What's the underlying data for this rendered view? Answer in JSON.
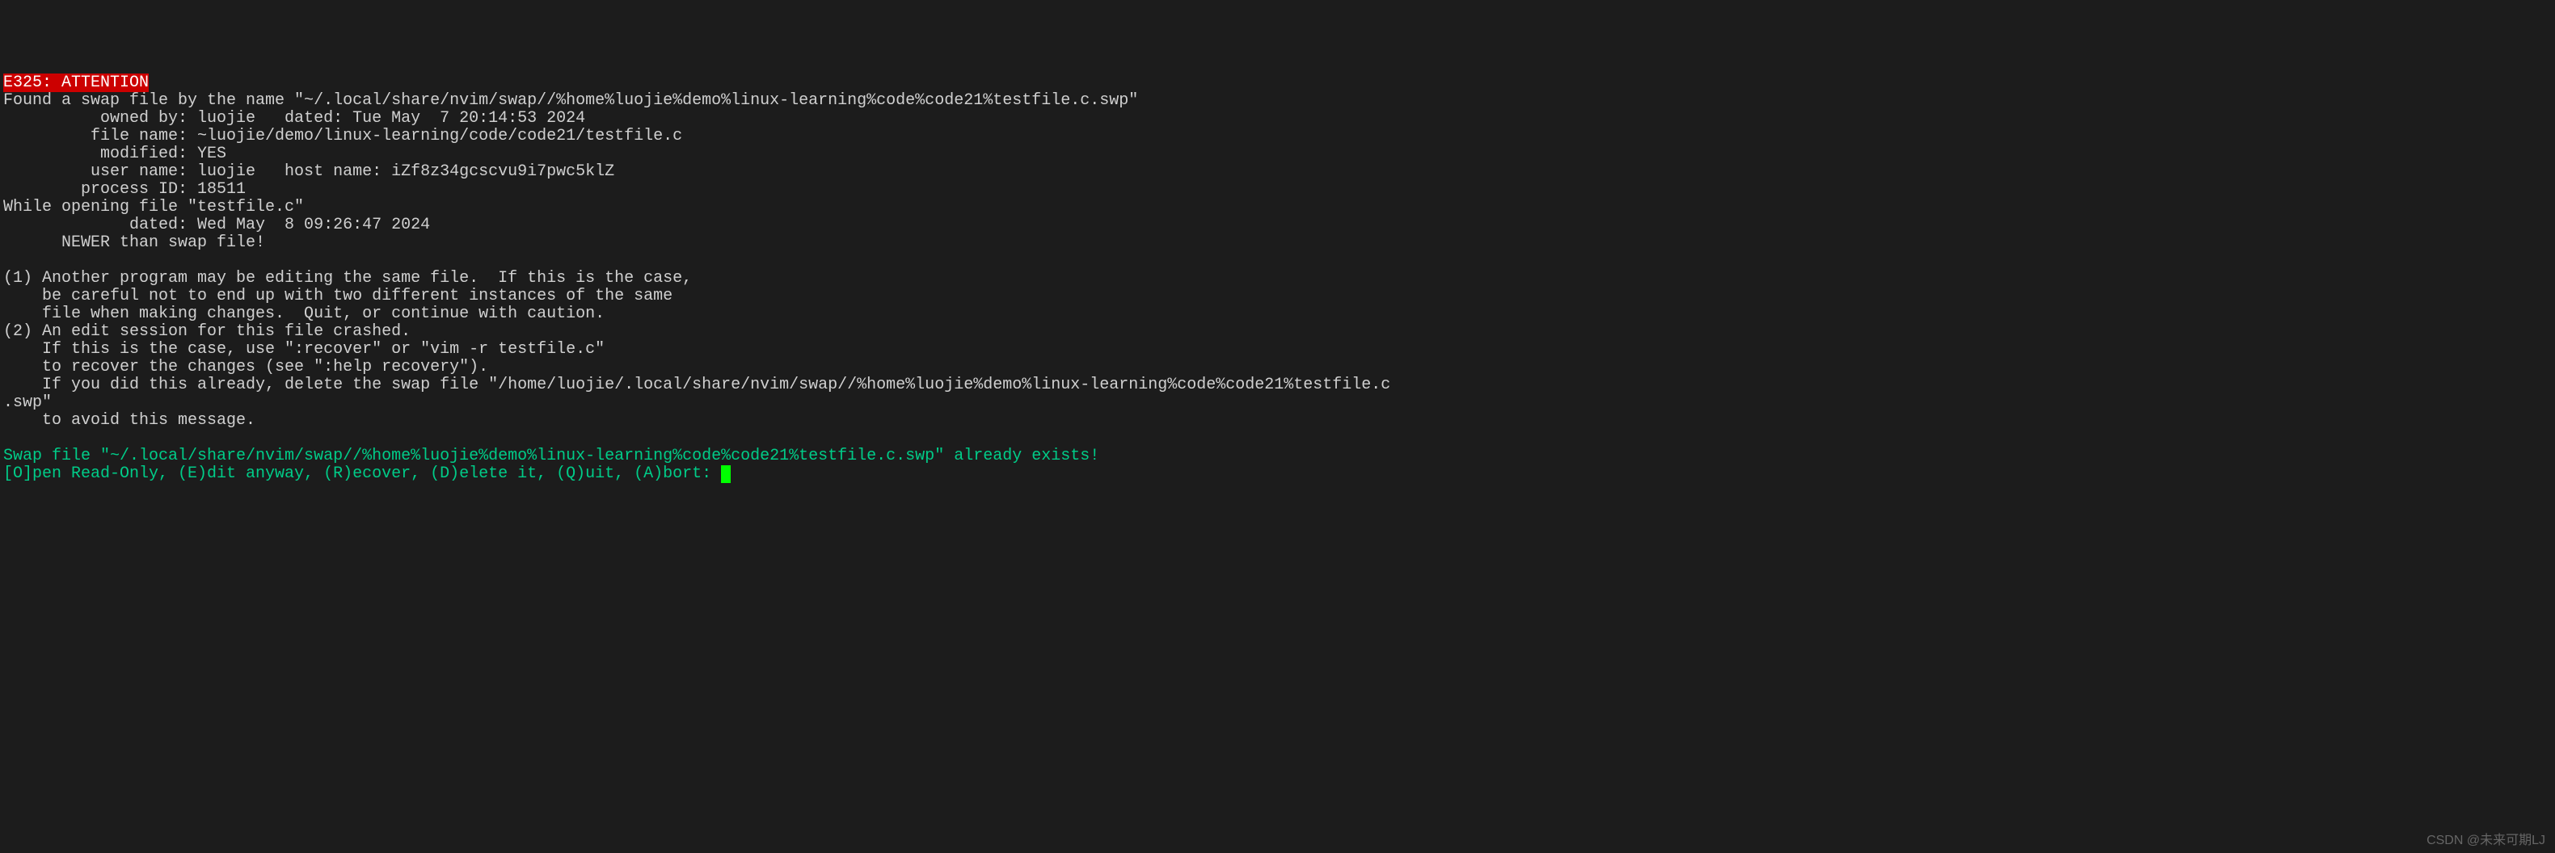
{
  "error": {
    "code": "E325: ATTENTION"
  },
  "lines": {
    "l1": "Found a swap file by the name \"~/.local/share/nvim/swap//%home%luojie%demo%linux-learning%code%code21%testfile.c.swp\"",
    "l2": "          owned by: luojie   dated: Tue May  7 20:14:53 2024",
    "l3": "         file name: ~luojie/demo/linux-learning/code/code21/testfile.c",
    "l4": "          modified: YES",
    "l5": "         user name: luojie   host name: iZf8z34gcscvu9i7pwc5klZ",
    "l6": "        process ID: 18511",
    "l7": "While opening file \"testfile.c\"",
    "l8": "             dated: Wed May  8 09:26:47 2024",
    "l9": "      NEWER than swap file!",
    "l10": "",
    "l11": "(1) Another program may be editing the same file.  If this is the case,",
    "l12": "    be careful not to end up with two different instances of the same",
    "l13": "    file when making changes.  Quit, or continue with caution.",
    "l14": "(2) An edit session for this file crashed.",
    "l15": "    If this is the case, use \":recover\" or \"vim -r testfile.c\"",
    "l16": "    to recover the changes (see \":help recovery\").",
    "l17": "    If you did this already, delete the swap file \"/home/luojie/.local/share/nvim/swap//%home%luojie%demo%linux-learning%code%code21%testfile.c",
    "l18": ".swp\"",
    "l19": "    to avoid this message.",
    "l20": ""
  },
  "prompt": {
    "swap_exists": "Swap file \"~/.local/share/nvim/swap//%home%luojie%demo%linux-learning%code%code21%testfile.c.swp\" already exists!",
    "options": "[O]pen Read-Only, (E)dit anyway, (R)ecover, (D)elete it, (Q)uit, (A)bort: "
  },
  "watermark": "CSDN @未来可期LJ"
}
